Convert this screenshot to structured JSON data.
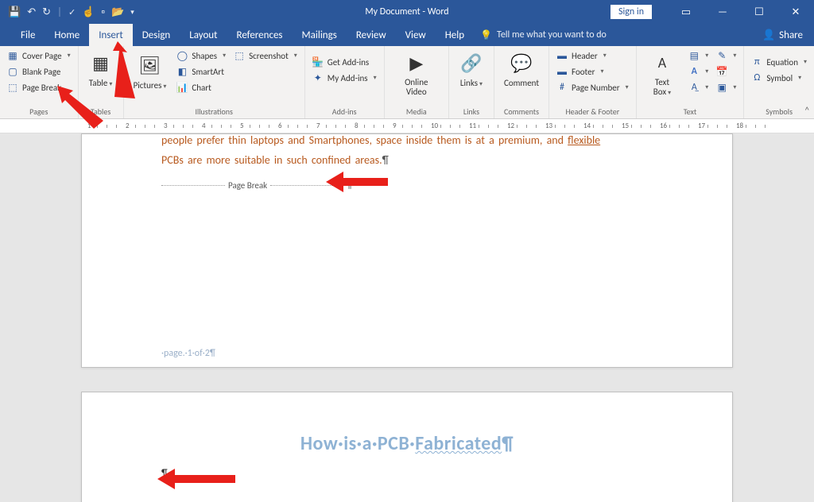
{
  "title": "My Document  -  Word",
  "signin": "Sign in",
  "tabs": [
    "File",
    "Home",
    "Insert",
    "Design",
    "Layout",
    "References",
    "Mailings",
    "Review",
    "View",
    "Help"
  ],
  "active_tab": "Insert",
  "tellme": "Tell me what you want to do",
  "share": "Share",
  "ribbon": {
    "pages": {
      "label": "Pages",
      "cover": "Cover Page",
      "blank": "Blank Page",
      "pbreak": "Page Break"
    },
    "tables": {
      "label": "Tables",
      "table": "Table"
    },
    "illustrations": {
      "label": "Illustrations",
      "pictures": "Pictures",
      "shapes": "Shapes",
      "smartart": "SmartArt",
      "chart": "Chart",
      "screenshot": "Screenshot"
    },
    "addins": {
      "label": "Add-ins",
      "get": "Get Add-ins",
      "my": "My Add-ins"
    },
    "media": {
      "label": "Media",
      "video": "Online Video"
    },
    "links": {
      "label": "Links",
      "links": "Links"
    },
    "comments": {
      "label": "Comments",
      "comment": "Comment"
    },
    "headerfooter": {
      "label": "Header & Footer",
      "header": "Header",
      "footer": "Footer",
      "pagenum": "Page Number"
    },
    "text": {
      "label": "Text",
      "textbox": "Text Box"
    },
    "symbols": {
      "label": "Symbols",
      "equation": "Equation",
      "symbol": "Symbol"
    }
  },
  "ruler_numbers": [
    1,
    2,
    3,
    4,
    5,
    6,
    7,
    8,
    9,
    10,
    11,
    12,
    13,
    14,
    15,
    16,
    17,
    18
  ],
  "doc": {
    "orange_line1": "people prefer thin laptops and Smartphones, space inside them is at a premium, and ",
    "orange_link": "flexible",
    "orange_line2": "PCBs are more suitable in such confined areas.",
    "pagebreak": "Page Break",
    "footer": "·page.·1·of·2¶",
    "heading_pre": "How·is·a·PCB·",
    "heading_under": "Fabricated",
    "heading_post": "¶",
    "p2_para": "¶"
  }
}
